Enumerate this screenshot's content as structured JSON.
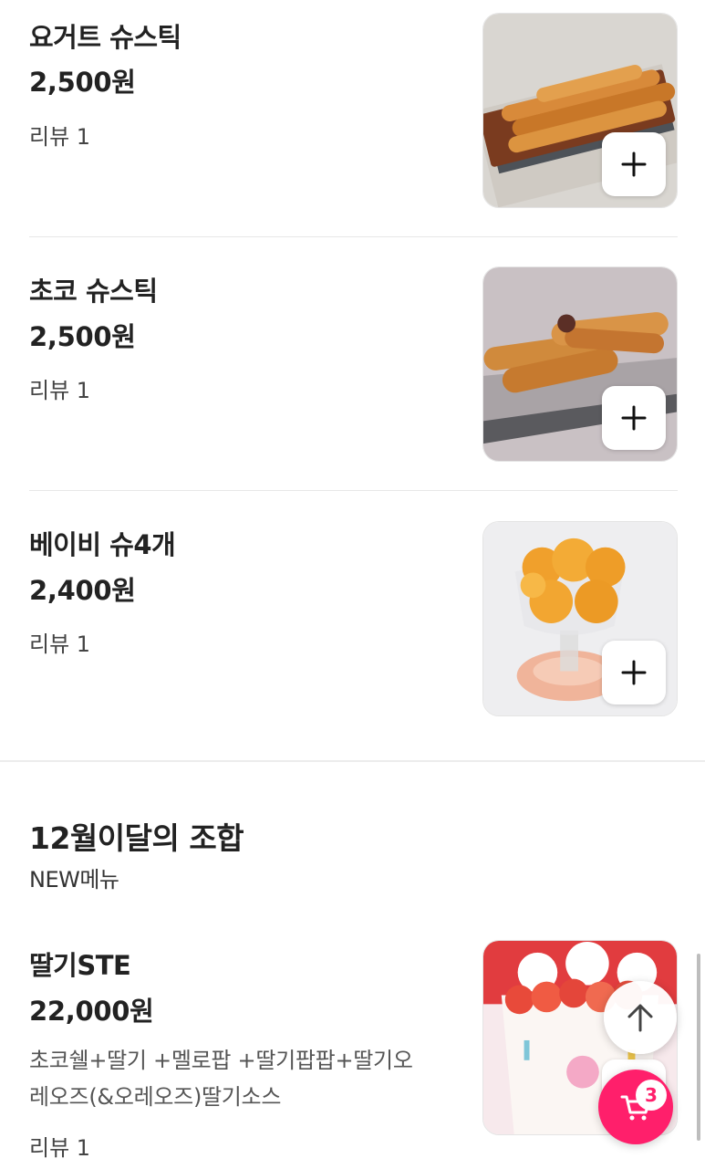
{
  "menu_items": [
    {
      "name": "요거트 슈스틱",
      "price": "2,500원",
      "review": "리뷰 1",
      "image": "yogurt-choux-stick-photo"
    },
    {
      "name": "초코 슈스틱",
      "price": "2,500원",
      "review": "리뷰 1",
      "image": "choco-choux-stick-photo"
    },
    {
      "name": "베이비 슈4개",
      "price": "2,400원",
      "review": "리뷰 1",
      "image": "baby-choux-cup-photo"
    }
  ],
  "section": {
    "title": "12월이달의 조합",
    "subtitle": "NEW메뉴"
  },
  "featured_item": {
    "name": "딸기STE",
    "price": "22,000원",
    "description_line1": "초코쉘+딸기 +멜로팝 +딸기팝팝+딸기오",
    "description_line2": "레오즈(&오레오즈)딸기소스",
    "review": "리뷰 1",
    "image": "strawberry-ice-cream-cup-photo"
  },
  "floating": {
    "scroll_top_icon": "arrow-up-icon",
    "cart_icon": "cart-icon",
    "cart_count": "3",
    "cart_color": "#ff1f6b"
  }
}
